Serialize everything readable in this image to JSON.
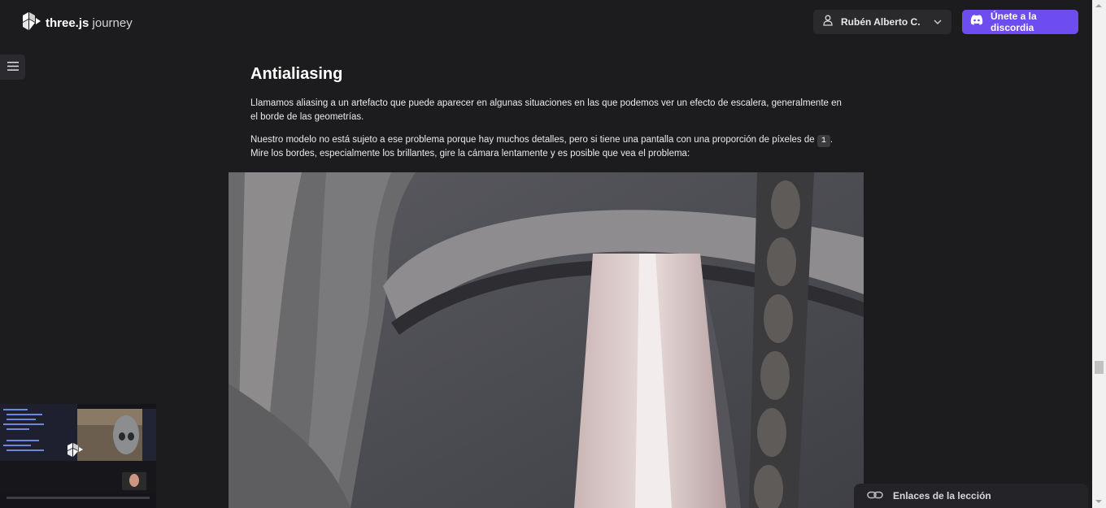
{
  "header": {
    "logo_bold": "three.js",
    "logo_light": " journey",
    "user_name": "Rubén Alberto C.",
    "discord_label": "Únete a la discordia"
  },
  "article": {
    "title": "Antialiasing",
    "p1": "Llamamos aliasing a un artefacto que puede aparecer en algunas situaciones en las que podemos ver un efecto de escalera, generalmente en el borde de las geometrías.",
    "p2_before": "Nuestro modelo no está sujeto a ese problema porque hay muchos detalles, pero si tiene una pantalla con una proporción de píxeles de ",
    "p2_code": "1",
    "p2_after": ". Mire los bordes, especialmente los brillantes, gire la cámara lentamente y es posible que vea el problema:"
  },
  "links_panel": {
    "label": "Enlaces de la lección"
  },
  "colors": {
    "background": "#1c1b1d",
    "accent": "#6d4cf0"
  },
  "icons": [
    "threejs-journey-logo-icon",
    "user-icon",
    "chevron-down-icon",
    "discord-icon",
    "hamburger-menu-icon",
    "link-icon"
  ]
}
